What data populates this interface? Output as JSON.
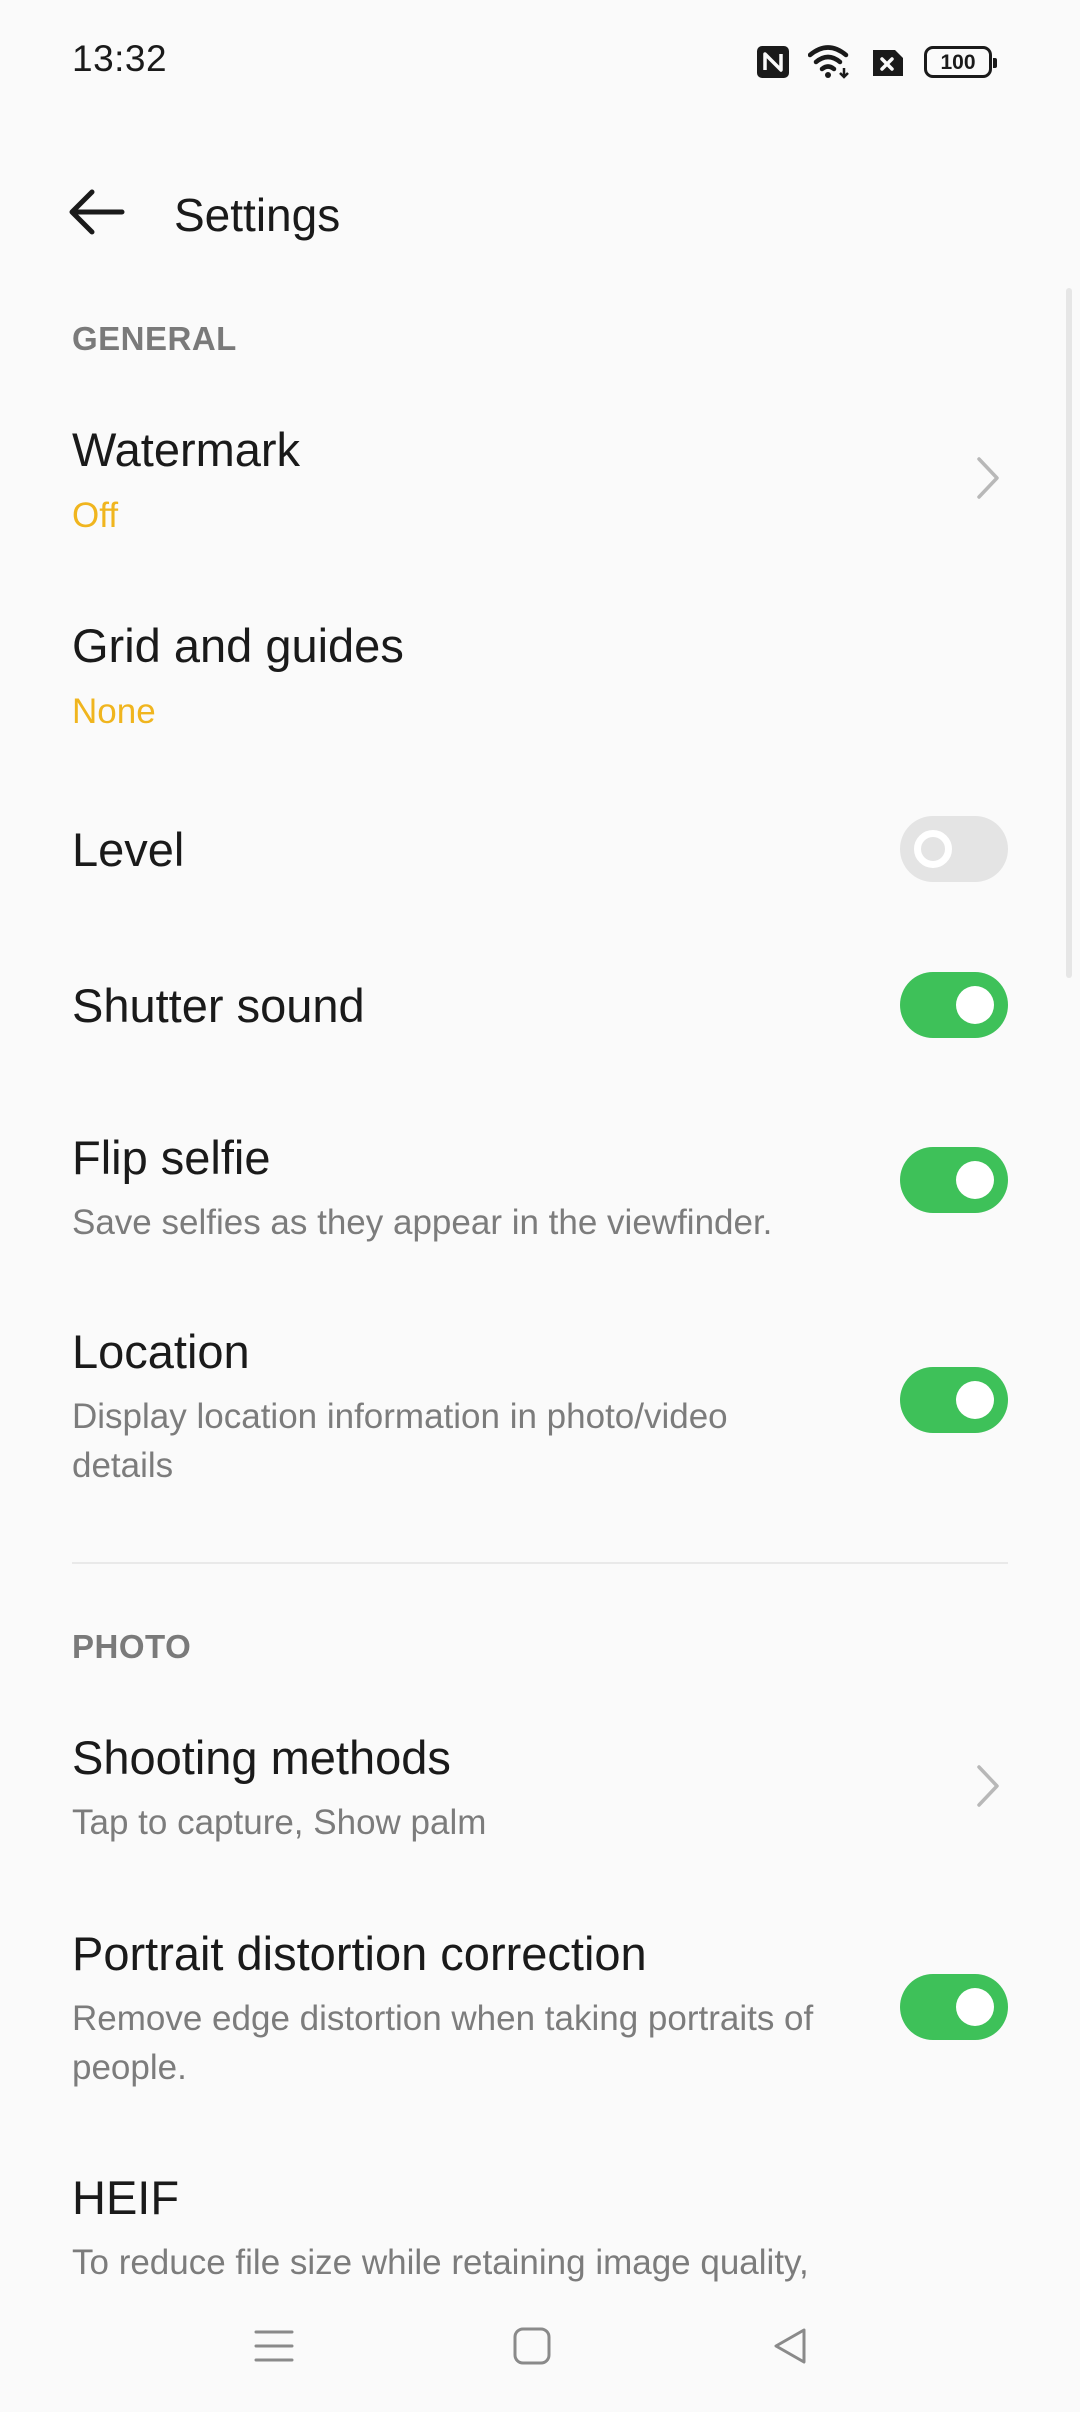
{
  "status_bar": {
    "time": "13:32",
    "battery": "100",
    "icons": [
      "nfc-icon",
      "wifi-icon",
      "sim-error-icon",
      "battery-icon"
    ]
  },
  "header": {
    "title": "Settings",
    "back_icon": "arrow-left-icon"
  },
  "sections": {
    "general": {
      "label": "GENERAL",
      "watermark": {
        "title": "Watermark",
        "value": "Off"
      },
      "grid": {
        "title": "Grid and guides",
        "value": "None"
      },
      "level": {
        "title": "Level",
        "enabled": false
      },
      "shutter_sound": {
        "title": "Shutter sound",
        "enabled": true
      },
      "flip_selfie": {
        "title": "Flip selfie",
        "description": "Save selfies as they appear in the viewfinder.",
        "enabled": true
      },
      "location": {
        "title": "Location",
        "description": "Display location information in photo/video details",
        "enabled": true
      }
    },
    "photo": {
      "label": "PHOTO",
      "shooting_methods": {
        "title": "Shooting methods",
        "value": "Tap to capture, Show palm"
      },
      "portrait_correction": {
        "title": "Portrait distortion correction",
        "description": "Remove edge distortion when taking portraits of people.",
        "enabled": true
      },
      "heif": {
        "title": "HEIF",
        "description": "To reduce file size while retaining image quality,"
      }
    }
  },
  "colors": {
    "accent_value": "#f0b51e",
    "toggle_on": "#3ec159",
    "toggle_off": "#e4e4e4",
    "section_header": "#7a7a7a"
  },
  "nav_bar": {
    "icons": [
      "menu-icon",
      "home-square-icon",
      "back-triangle-icon"
    ]
  }
}
